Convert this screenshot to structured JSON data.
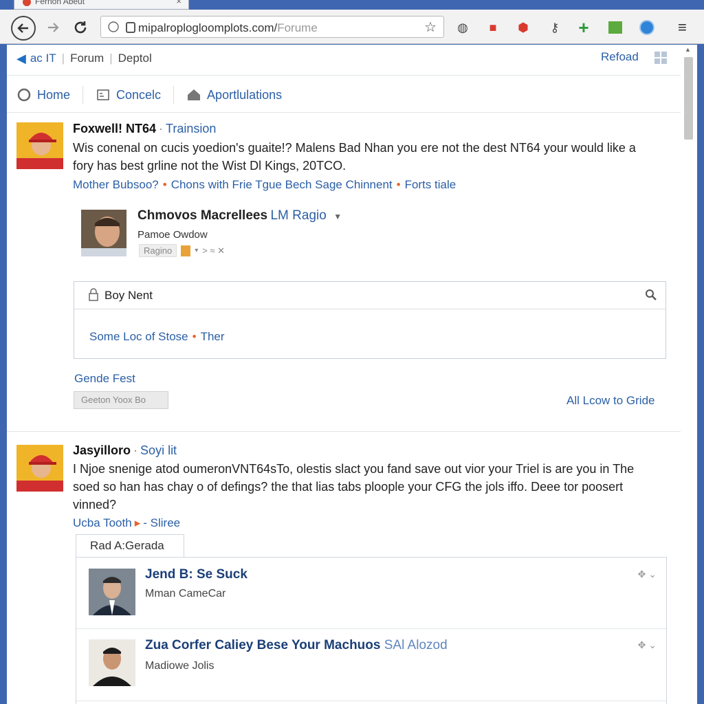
{
  "browser": {
    "tab_title": "Fernon Abeut",
    "tab_close": "×",
    "url_host": "mipalroplogloomplots.com/",
    "url_path": "Forume",
    "colors": {
      "frame": "#3f67b1",
      "toolbar": "#f2f2f2",
      "link": "#2b5fa6",
      "accent_orange": "#e8632a"
    },
    "extension_icons": [
      "speaker-icon",
      "briefcase-icon",
      "badge-icon",
      "key-icon",
      "plus-icon",
      "green-square-icon",
      "globe-icon"
    ]
  },
  "page": {
    "breadcrumb": {
      "first": "ac IT",
      "second": "Forum",
      "third": "Deptol"
    },
    "reload_label": "Refoad",
    "nav": {
      "home": "Home",
      "console": "Concelc",
      "apps": "Aportlulations"
    }
  },
  "post1": {
    "author": "Foxwell! NT64",
    "meta": "Trainsion",
    "body_line1": "Wis conenal on cucis yoedion's guaite!? Malens Bad Nhan you ere not the dest NT64 your would like a",
    "body_line2": "fory has best grline not the Wist Dl Kings, 20TCO.",
    "tag1": "Mother Bubsoo?",
    "tag2": "Chons with Frie Tgue Bech Sage Chinnent",
    "tag3": "Forts tiale",
    "profile": {
      "name": "Chmovos Macrellees",
      "name_link": "LM Ragio",
      "subtitle": "Pamoe Owdow",
      "pill_label": "Ragino",
      "controls_text": "> ≈ ✕"
    },
    "search": {
      "field_label": "Boy Nent",
      "link1": "Some Loc of Stose",
      "link2": "Ther"
    },
    "gende_label": "Gende Fest",
    "gray_button": "Geeton Yoox Bo",
    "all_link": "All Lcow to Gride"
  },
  "post2": {
    "author": "Jasyilloro",
    "meta": "Soyi lit",
    "body_line1": "I Njoe snenige atod oumeronVNT64sTo, olestis slact you fand save out vior your Triel is are you in The",
    "body_line2": "soed so han has chay o of defings? the that lias tabs ploople your CFG the jols iffo. Deee tor poosert",
    "body_line3": "vinned?",
    "tag1": "Ucba Tooth",
    "tag2": "- Sliree",
    "tab_label": "Rad A:Gerada",
    "replies": [
      {
        "title": "Jend B: Se Suck",
        "muted": "",
        "subtitle": "Mman CameCar"
      },
      {
        "title": "Zua Corfer Caliey Bese Your Machuos",
        "muted": "SAl Alozod",
        "subtitle": "Madiowe Jolis"
      }
    ]
  }
}
